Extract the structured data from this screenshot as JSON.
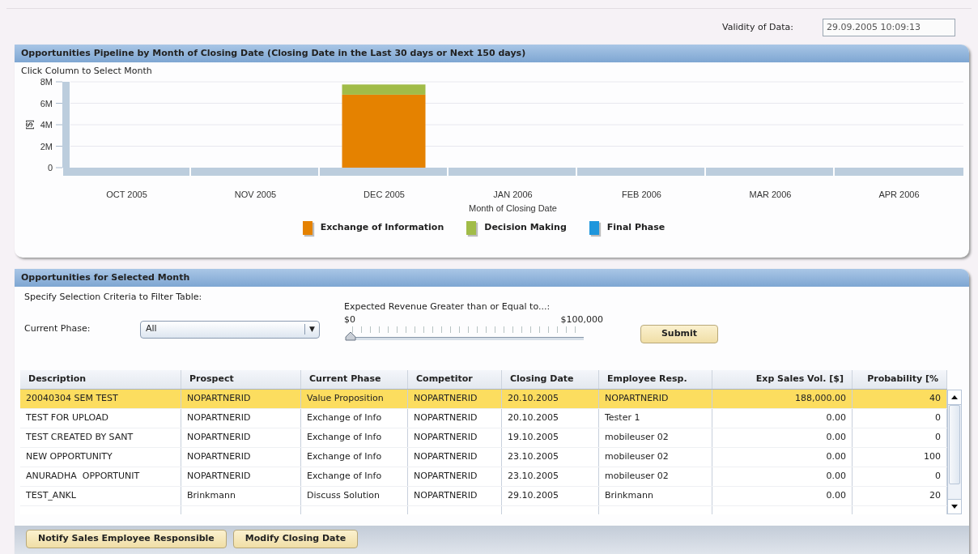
{
  "validity": {
    "label": "Validity of Data:",
    "value": "29.09.2005 10:09:13"
  },
  "pipeline_panel": {
    "title": "Opportunities Pipeline by Month of Closing Date (Closing Date in the Last 30 days or Next 150 days)",
    "hint": "Click Column to Select Month",
    "chart_data": {
      "type": "bar",
      "stacked": true,
      "xlabel": "Month of Closing Date",
      "ylabel": "[$]",
      "categories": [
        "OCT 2005",
        "NOV 2005",
        "DEC 2005",
        "JAN 2006",
        "FEB 2006",
        "MAR 2006",
        "APR 2006"
      ],
      "series": [
        {
          "name": "Exchange of Information",
          "color": "#e58200",
          "values": [
            0,
            0,
            6800000,
            0,
            0,
            0,
            0
          ]
        },
        {
          "name": "Decision Making",
          "color": "#a1bc48",
          "values": [
            0,
            0,
            950000,
            0,
            0,
            0,
            0
          ]
        },
        {
          "name": "Final Phase",
          "color": "#1e96dc",
          "values": [
            0,
            0,
            0,
            0,
            0,
            0,
            0
          ]
        }
      ],
      "grid": true,
      "ylim": [
        0,
        8000000
      ],
      "yticks": [
        {
          "value": 0,
          "label": "0"
        },
        {
          "value": 2000000,
          "label": "2M"
        },
        {
          "value": 4000000,
          "label": "4M"
        },
        {
          "value": 6000000,
          "label": "6M"
        },
        {
          "value": 8000000,
          "label": "8M"
        }
      ]
    }
  },
  "opportunities_panel": {
    "title": "Opportunities for Selected Month",
    "criteria_label": "Specify Selection Criteria to Filter Table:",
    "phase_filter": {
      "label": "Current Phase:",
      "value": "All",
      "arrow": "▼"
    },
    "revenue_slider": {
      "label": "Expected Revenue Greater than or Equal to...:",
      "min_label": "$0",
      "max_label": "$100,000",
      "level": 0
    },
    "submit_button": "Submit",
    "table": {
      "columns": [
        "Description",
        "Prospect",
        "Current Phase",
        "Competitor",
        "Closing Date",
        "Employee Resp.",
        "Exp Sales Vol. [$]",
        "Probability [%"
      ],
      "rows": [
        {
          "selected": true,
          "cells": [
            "20040304 SEM TEST",
            "NOPARTNERID",
            "Value Proposition",
            "NOPARTNERID",
            "20.10.2005",
            "NOPARTNERID",
            "188,000.00",
            "40"
          ]
        },
        {
          "selected": false,
          "cells": [
            "TEST FOR UPLOAD",
            "NOPARTNERID",
            "Exchange of Info",
            "NOPARTNERID",
            "20.10.2005",
            "Tester 1",
            "0.00",
            "0"
          ]
        },
        {
          "selected": false,
          "cells": [
            "TEST CREATED BY SANT",
            "NOPARTNERID",
            "Exchange of Info",
            "NOPARTNERID",
            "19.10.2005",
            "mobileuser 02",
            "0.00",
            "0"
          ]
        },
        {
          "selected": false,
          "cells": [
            "NEW OPPORTUNITY",
            "NOPARTNERID",
            "Exchange of Info",
            "NOPARTNERID",
            "23.10.2005",
            "mobileuser 02",
            "0.00",
            "100"
          ]
        },
        {
          "selected": false,
          "cells": [
            "ANURADHA  OPPORTUNIT",
            "NOPARTNERID",
            "Exchange of Info",
            "NOPARTNERID",
            "23.10.2005",
            "mobileuser 02",
            "0.00",
            "0"
          ]
        },
        {
          "selected": false,
          "cells": [
            "TEST_ANKL",
            "Brinkmann",
            "Discuss Solution",
            "NOPARTNERID",
            "29.10.2005",
            "Brinkmann",
            "0.00",
            "20"
          ]
        }
      ]
    },
    "buttons": [
      "Notify Sales Employee Responsible",
      "Modify Closing Date"
    ]
  }
}
